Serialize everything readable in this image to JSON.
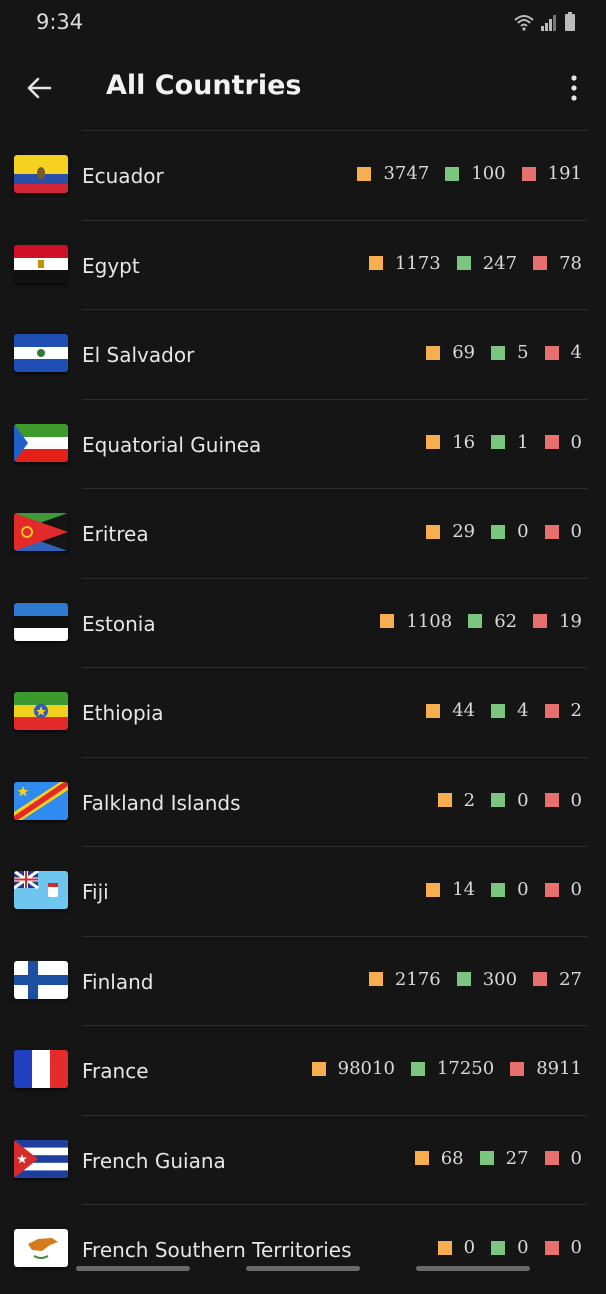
{
  "status": {
    "time": "9:34"
  },
  "header": {
    "title": "All Countries"
  },
  "colors": {
    "confirmed": "#f7ae4f",
    "recovered": "#7bc67e",
    "deaths": "#e7706f",
    "background": "#151515"
  },
  "countries": [
    {
      "name": "Ecuador",
      "confirmed": "3747",
      "recovered": "100",
      "deaths": "191",
      "flag": "ecuador-flag-icon"
    },
    {
      "name": "Egypt",
      "confirmed": "1173",
      "recovered": "247",
      "deaths": "78",
      "flag": "egypt-flag-icon"
    },
    {
      "name": "El Salvador",
      "confirmed": "69",
      "recovered": "5",
      "deaths": "4",
      "flag": "el-salvador-flag-icon"
    },
    {
      "name": "Equatorial Guinea",
      "confirmed": "16",
      "recovered": "1",
      "deaths": "0",
      "flag": "equatorial-guinea-flag-icon"
    },
    {
      "name": "Eritrea",
      "confirmed": "29",
      "recovered": "0",
      "deaths": "0",
      "flag": "eritrea-flag-icon"
    },
    {
      "name": "Estonia",
      "confirmed": "1108",
      "recovered": "62",
      "deaths": "19",
      "flag": "estonia-flag-icon"
    },
    {
      "name": "Ethiopia",
      "confirmed": "44",
      "recovered": "4",
      "deaths": "2",
      "flag": "ethiopia-flag-icon"
    },
    {
      "name": "Falkland Islands",
      "confirmed": "2",
      "recovered": "0",
      "deaths": "0",
      "flag": "congo-flag-icon"
    },
    {
      "name": "Fiji",
      "confirmed": "14",
      "recovered": "0",
      "deaths": "0",
      "flag": "fiji-flag-icon"
    },
    {
      "name": "Finland",
      "confirmed": "2176",
      "recovered": "300",
      "deaths": "27",
      "flag": "finland-flag-icon"
    },
    {
      "name": "France",
      "confirmed": "98010",
      "recovered": "17250",
      "deaths": "8911",
      "flag": "france-flag-icon"
    },
    {
      "name": "French Guiana",
      "confirmed": "68",
      "recovered": "27",
      "deaths": "0",
      "flag": "cuba-flag-icon"
    },
    {
      "name": "French Southern Territories",
      "confirmed": "0",
      "recovered": "0",
      "deaths": "0",
      "flag": "cyprus-flag-icon"
    }
  ]
}
